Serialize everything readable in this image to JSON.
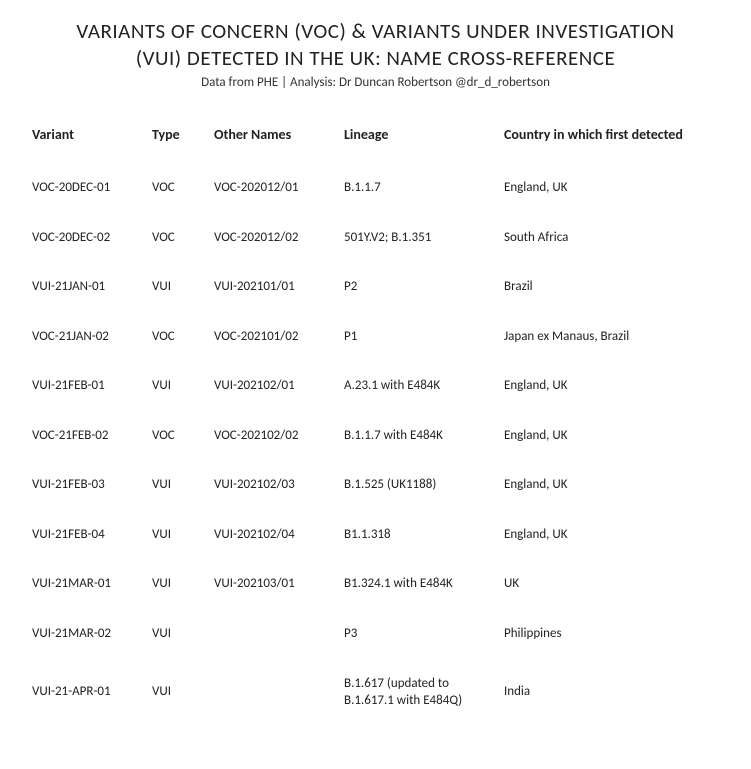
{
  "header": {
    "title_line1": "VARIANTS OF CONCERN (VOC) & VARIANTS UNDER INVESTIGATION",
    "title_line2": "(VUI) DETECTED IN THE UK: NAME CROSS-REFERENCE",
    "subtitle": "Data from PHE | Analysis: Dr Duncan Robertson @dr_d_robertson"
  },
  "table": {
    "columns": [
      "Variant",
      "Type",
      "Other Names",
      "Lineage",
      "Country in which first detected"
    ],
    "rows": [
      {
        "variant": "VOC-20DEC-01",
        "type": "VOC",
        "other": "VOC-202012/01",
        "lineage": "B.1.1.7",
        "country": "England, UK"
      },
      {
        "variant": "VOC-20DEC-02",
        "type": "VOC",
        "other": "VOC-202012/02",
        "lineage": "501Y.V2; B.1.351",
        "country": "South Africa"
      },
      {
        "variant": "VUI-21JAN-01",
        "type": "VUI",
        "other": "VUI-202101/01",
        "lineage": "P2",
        "country": "Brazil"
      },
      {
        "variant": "VOC-21JAN-02",
        "type": "VOC",
        "other": "VOC-202101/02",
        "lineage": "P1",
        "country": "Japan ex Manaus, Brazil"
      },
      {
        "variant": "VUI-21FEB-01",
        "type": "VUI",
        "other": "VUI-202102/01",
        "lineage": "A.23.1 with E484K",
        "country": "England, UK"
      },
      {
        "variant": "VOC-21FEB-02",
        "type": "VOC",
        "other": "VOC-202102/02",
        "lineage": "B.1.1.7 with E484K",
        "country": "England, UK"
      },
      {
        "variant": "VUI-21FEB-03",
        "type": "VUI",
        "other": "VUI-202102/03",
        "lineage": "B.1.525 (UK1188)",
        "country": "England, UK"
      },
      {
        "variant": "VUI-21FEB-04",
        "type": "VUI",
        "other": "VUI-202102/04",
        "lineage": "B1.1.318",
        "country": "England, UK"
      },
      {
        "variant": "VUI-21MAR-01",
        "type": "VUI",
        "other": "VUI-202103/01",
        "lineage": "B1.324.1 with E484K",
        "country": "UK"
      },
      {
        "variant": "VUI-21MAR-02",
        "type": "VUI",
        "other": "",
        "lineage": "P3",
        "country": "Philippines"
      },
      {
        "variant": "VUI-21-APR-01",
        "type": "VUI",
        "other": "",
        "lineage": "B.1.617 (updated to B.1.617.1 with E484Q)",
        "country": "India"
      }
    ]
  }
}
